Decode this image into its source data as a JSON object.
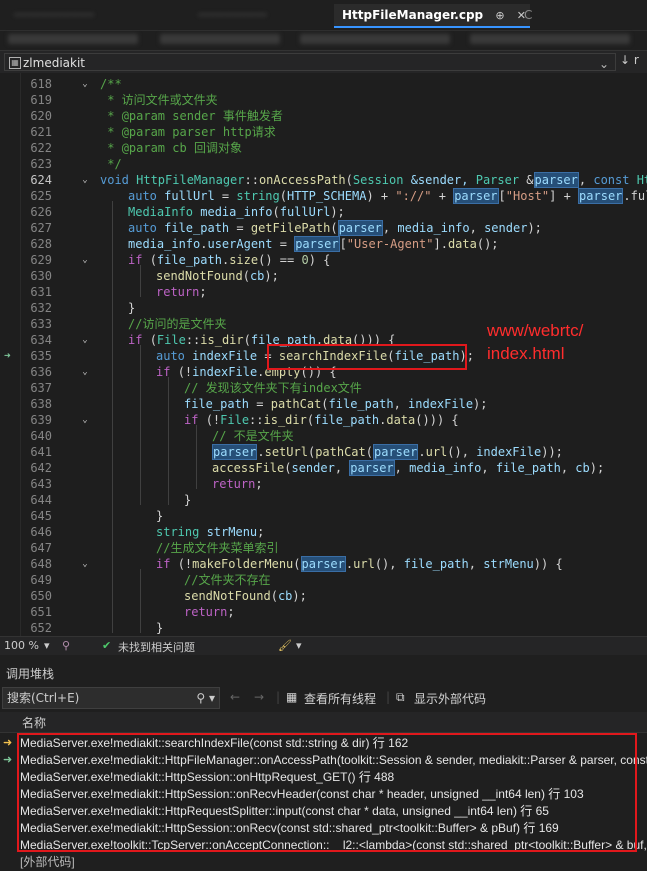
{
  "tabs": {
    "blurred": [
      "·····················",
      "··················",
      "························"
    ],
    "active": "HttpFileManager.cpp",
    "active_pin": "⊕",
    "active_close": "✕",
    "next": "C"
  },
  "navbar": {
    "project": "zlmediakit",
    "right": "↓ r"
  },
  "editor": {
    "line_numbers": [
      "618",
      "619",
      "620",
      "621",
      "622",
      "623",
      "624",
      "625",
      "626",
      "627",
      "628",
      "629",
      "630",
      "631",
      "632",
      "633",
      "634",
      "635",
      "636",
      "637",
      "638",
      "639",
      "640",
      "641",
      "642",
      "643",
      "644",
      "645",
      "646",
      "647",
      "648",
      "649",
      "650",
      "651",
      "652"
    ],
    "annotation_line1": "www/webrtc/",
    "annotation_line2": "index.html",
    "lines": {
      "l618": "/**",
      "l619": " * 访问文件或文件夹",
      "l620a": " * ",
      "l620b": "@param",
      "l620c": " sender 事件触发者",
      "l621a": " * ",
      "l621b": "@param",
      "l621c": " parser http请求",
      "l622a": " * ",
      "l622b": "@param",
      "l622c": " cb 回调对象",
      "l623": " */",
      "l624": [
        "void ",
        "HttpFileManager",
        "::",
        "onAccessPath",
        "(",
        "Session ",
        "&sender, ",
        "Parser ",
        "&",
        "parser",
        ", ",
        "const ",
        "HttpF"
      ],
      "l625": [
        "auto ",
        "fullUrl",
        " = ",
        "string",
        "(",
        "HTTP_SCHEMA",
        ") + ",
        "\"://\"",
        " + ",
        "parser",
        "[",
        "\"Host\"",
        "] + ",
        "parser",
        ".fullUr"
      ],
      "l626": [
        "MediaInfo ",
        "media_info",
        "(",
        "fullUrl",
        ");"
      ],
      "l627": [
        "auto ",
        "file_path",
        " = ",
        "getFilePath",
        "(",
        "parser",
        ", ",
        "media_info",
        ", ",
        "sender",
        ");"
      ],
      "l628": [
        "media_info",
        ".",
        "userAgent",
        " = ",
        "parser",
        "[",
        "\"User-Agent\"",
        "].",
        "data",
        "();"
      ],
      "l629": [
        "if ",
        "(",
        "file_path",
        ".",
        "size",
        "() == ",
        "0",
        ") {"
      ],
      "l630": [
        "sendNotFound",
        "(",
        "cb",
        ");"
      ],
      "l631": [
        "return",
        ";"
      ],
      "l632": "}",
      "l633": "//访问的是文件夹",
      "l634": [
        "if ",
        "(",
        "File",
        "::",
        "is_dir",
        "(",
        "file_path",
        ".",
        "data",
        "())) {"
      ],
      "l635": [
        "auto ",
        "indexFile",
        " = ",
        "searchIndexFile",
        "(",
        "file_path",
        ");"
      ],
      "l636": [
        "if ",
        "(!",
        "indexFile",
        ".",
        "empty",
        "()) {"
      ],
      "l637": "// 发现该文件夹下有index文件",
      "l638": [
        "file_path",
        " = ",
        "pathCat",
        "(",
        "file_path",
        ", ",
        "indexFile",
        ");"
      ],
      "l639": [
        "if ",
        "(!",
        "File",
        "::",
        "is_dir",
        "(",
        "file_path",
        ".",
        "data",
        "())) {"
      ],
      "l640": "// 不是文件夹",
      "l641": [
        "parser",
        ".",
        "setUrl",
        "(",
        "pathCat",
        "(",
        "parser",
        ".",
        "url",
        "(), ",
        "indexFile",
        "));"
      ],
      "l642": [
        "accessFile",
        "(",
        "sender",
        ", ",
        "parser",
        ", ",
        "media_info",
        ", ",
        "file_path",
        ", ",
        "cb",
        ");"
      ],
      "l643": [
        "return",
        ";"
      ],
      "l644": "}",
      "l645": "}",
      "l646": [
        "string ",
        "strMenu",
        ";"
      ],
      "l647": "//生成文件夹菜单索引",
      "l648": [
        "if ",
        "(!",
        "makeFolderMenu",
        "(",
        "parser",
        ".",
        "url",
        "(), ",
        "file_path",
        ", ",
        "strMenu",
        ")) {"
      ],
      "l649": "//文件夹不存在",
      "l650": [
        "sendNotFound",
        "(",
        "cb",
        ");"
      ],
      "l651": [
        "return",
        ";"
      ],
      "l652": "}"
    }
  },
  "statusbar": {
    "zoom": "100 %",
    "issues": "未找到相关问题"
  },
  "callstack": {
    "title": "调用堆栈",
    "search_placeholder": "搜索(Ctrl+E)",
    "view_all_threads": "查看所有线程",
    "show_external": "显示外部代码",
    "column_name": "名称",
    "frames": [
      "MediaServer.exe!mediakit::searchIndexFile(const std::string & dir) 行 162",
      "MediaServer.exe!mediakit::HttpFileManager::onAccessPath(toolkit::Session & sender, mediakit::Parser & parser, const st",
      "MediaServer.exe!mediakit::HttpSession::onHttpRequest_GET() 行 488",
      "MediaServer.exe!mediakit::HttpSession::onRecvHeader(const char * header, unsigned __int64 len) 行 103",
      "MediaServer.exe!mediakit::HttpRequestSplitter::input(const char * data, unsigned __int64 len) 行 65",
      "MediaServer.exe!mediakit::HttpSession::onRecv(const std::shared_ptr<toolkit::Buffer> & pBuf) 行 169",
      "MediaServer.exe!toolkit::TcpServer::onAcceptConnection::__l2::<lambda>(const std::shared_ptr<toolkit::Buffer> & buf,",
      "[外部代码]"
    ]
  },
  "colors": {
    "accent": "#3794ff",
    "highlight_red": "#e0181c",
    "annotation": "#ff2d2d"
  }
}
